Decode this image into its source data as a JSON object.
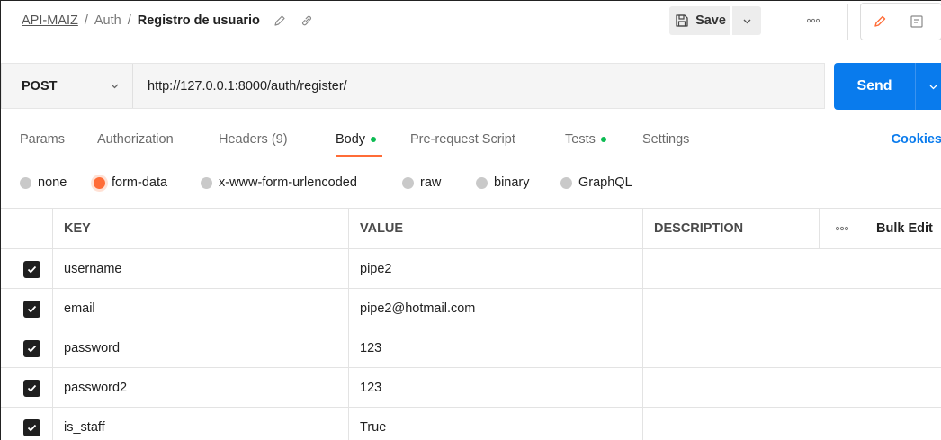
{
  "breadcrumb": {
    "collection": "API-MAIZ",
    "folder": "Auth",
    "request_name": "Registro de usuario",
    "sep1": "/",
    "sep2": "/"
  },
  "header": {
    "save_label": "Save",
    "more_label": "ooo"
  },
  "request": {
    "method": "POST",
    "url": "http://127.0.0.1:8000/auth/register/",
    "send_label": "Send"
  },
  "tabs": [
    {
      "label": "Params",
      "active": false,
      "dot": false
    },
    {
      "label": "Authorization",
      "active": false,
      "dot": false
    },
    {
      "label": "Headers (9)",
      "active": false,
      "dot": false
    },
    {
      "label": "Body",
      "active": true,
      "dot": true
    },
    {
      "label": "Pre-request Script",
      "active": false,
      "dot": false
    },
    {
      "label": "Tests",
      "active": false,
      "dot": true
    },
    {
      "label": "Settings",
      "active": false,
      "dot": false
    }
  ],
  "cookies_label": "Cookies",
  "body_types": [
    {
      "label": "none",
      "selected": false
    },
    {
      "label": "form-data",
      "selected": true
    },
    {
      "label": "x-www-form-urlencoded",
      "selected": false
    },
    {
      "label": "raw",
      "selected": false
    },
    {
      "label": "binary",
      "selected": false
    },
    {
      "label": "GraphQL",
      "selected": false
    }
  ],
  "table": {
    "headers": {
      "key": "KEY",
      "value": "VALUE",
      "description": "DESCRIPTION",
      "more": "ooo",
      "bulk_edit": "Bulk Edit"
    },
    "rows": [
      {
        "key": "username",
        "value": "pipe2",
        "description": "",
        "checked": true
      },
      {
        "key": "email",
        "value": "pipe2@hotmail.com",
        "description": "",
        "checked": true
      },
      {
        "key": "password",
        "value": "123",
        "description": "",
        "checked": true
      },
      {
        "key": "password2",
        "value": "123",
        "description": "",
        "checked": true
      },
      {
        "key": "is_staff",
        "value": "True",
        "description": "",
        "checked": true
      }
    ]
  },
  "colors": {
    "accent_orange": "#ff6c37",
    "send_blue": "#097bed",
    "dot_green": "#0cbb52"
  }
}
